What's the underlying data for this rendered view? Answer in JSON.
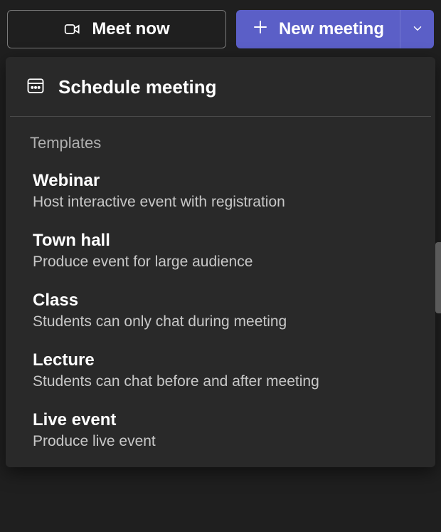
{
  "toolbar": {
    "meet_now_label": "Meet now",
    "new_meeting_label": "New meeting"
  },
  "dropdown": {
    "schedule_label": "Schedule meeting",
    "templates_heading": "Templates",
    "templates": [
      {
        "title": "Webinar",
        "desc": "Host interactive event with registration"
      },
      {
        "title": "Town hall",
        "desc": "Produce event for large audience"
      },
      {
        "title": "Class",
        "desc": "Students can only chat during meeting"
      },
      {
        "title": "Lecture",
        "desc": "Students can chat before and after meeting"
      },
      {
        "title": "Live event",
        "desc": "Produce live event"
      }
    ]
  }
}
